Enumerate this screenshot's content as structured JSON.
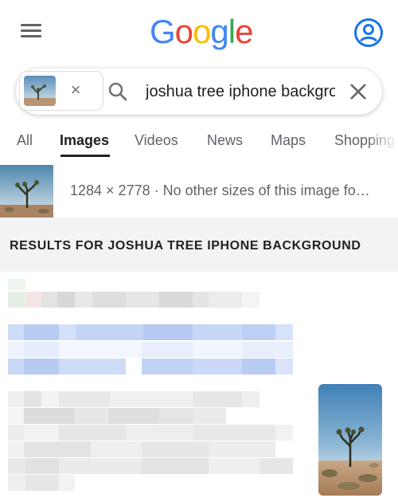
{
  "header": {
    "logo_letters": [
      {
        "ch": "G",
        "color": "#4285F4"
      },
      {
        "ch": "o",
        "color": "#EA4335"
      },
      {
        "ch": "o",
        "color": "#FBBC05"
      },
      {
        "ch": "g",
        "color": "#4285F4"
      },
      {
        "ch": "l",
        "color": "#34A853"
      },
      {
        "ch": "e",
        "color": "#EA4335"
      }
    ],
    "icons": {
      "menu": "hamburger-menu-icon",
      "account": "account-circle-icon"
    }
  },
  "search": {
    "query": "joshua tree iphone background",
    "icons": {
      "search": "search-icon",
      "clear": "close-icon",
      "chip_remove": "close-icon"
    }
  },
  "tabs": [
    {
      "label": "All",
      "active": false
    },
    {
      "label": "Images",
      "active": true
    },
    {
      "label": "Videos",
      "active": false
    },
    {
      "label": "News",
      "active": false
    },
    {
      "label": "Maps",
      "active": false
    },
    {
      "label": "Shopping",
      "active": false
    }
  ],
  "image_info": {
    "text": "1284 × 2778 · No other sizes of this image fo…"
  },
  "results": {
    "title": "RESULTS FOR JOSHUA TREE IPHONE BACKGROUND"
  },
  "colors": {
    "accent_blue": "#1a73e8",
    "band_gray": "#f1f3f4",
    "text_gray": "#5f6368"
  }
}
